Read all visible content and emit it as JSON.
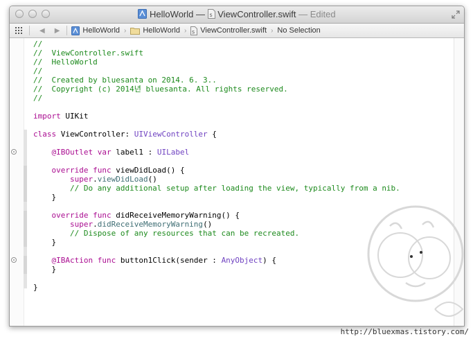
{
  "titlebar": {
    "project": "HelloWorld",
    "separator": "—",
    "file": "ViewController.swift",
    "status": "Edited"
  },
  "jumpbar": {
    "crumbs": [
      {
        "label": "HelloWorld",
        "icon": "xcode-project-icon"
      },
      {
        "label": "HelloWorld",
        "icon": "folder-icon"
      },
      {
        "label": "ViewController.swift",
        "icon": "swift-file-icon"
      },
      {
        "label": "No Selection",
        "icon": ""
      }
    ]
  },
  "code_lines": [
    [
      {
        "t": "//",
        "c": "c"
      }
    ],
    [
      {
        "t": "//  ViewController.swift",
        "c": "c"
      }
    ],
    [
      {
        "t": "//  HelloWorld",
        "c": "c"
      }
    ],
    [
      {
        "t": "//",
        "c": "c"
      }
    ],
    [
      {
        "t": "//  Created by bluesanta on 2014. 6. 3..",
        "c": "c"
      }
    ],
    [
      {
        "t": "//  Copyright (c) 2014년 bluesanta. All rights reserved.",
        "c": "c"
      }
    ],
    [
      {
        "t": "//",
        "c": "c"
      }
    ],
    [
      {
        "t": "",
        "c": ""
      }
    ],
    [
      {
        "t": "import",
        "c": "k"
      },
      {
        "t": " UIKit",
        "c": ""
      }
    ],
    [
      {
        "t": "",
        "c": ""
      }
    ],
    [
      {
        "t": "class",
        "c": "k"
      },
      {
        "t": " ViewController: ",
        "c": ""
      },
      {
        "t": "UIViewController",
        "c": "t"
      },
      {
        "t": " {",
        "c": ""
      }
    ],
    [
      {
        "t": "",
        "c": ""
      }
    ],
    [
      {
        "t": "    ",
        "c": ""
      },
      {
        "t": "@IBOutlet",
        "c": "k"
      },
      {
        "t": " ",
        "c": ""
      },
      {
        "t": "var",
        "c": "k"
      },
      {
        "t": " label1 : ",
        "c": ""
      },
      {
        "t": "UILabel",
        "c": "t"
      }
    ],
    [
      {
        "t": "",
        "c": ""
      }
    ],
    [
      {
        "t": "    ",
        "c": ""
      },
      {
        "t": "override",
        "c": "k"
      },
      {
        "t": " ",
        "c": ""
      },
      {
        "t": "func",
        "c": "k"
      },
      {
        "t": " viewDidLoad() {",
        "c": ""
      }
    ],
    [
      {
        "t": "        ",
        "c": ""
      },
      {
        "t": "super",
        "c": "k"
      },
      {
        "t": ".",
        "c": ""
      },
      {
        "t": "viewDidLoad",
        "c": "m"
      },
      {
        "t": "()",
        "c": ""
      }
    ],
    [
      {
        "t": "        // Do any additional setup after loading the view, typically from a nib.",
        "c": "c"
      }
    ],
    [
      {
        "t": "    }",
        "c": ""
      }
    ],
    [
      {
        "t": "",
        "c": ""
      }
    ],
    [
      {
        "t": "    ",
        "c": ""
      },
      {
        "t": "override",
        "c": "k"
      },
      {
        "t": " ",
        "c": ""
      },
      {
        "t": "func",
        "c": "k"
      },
      {
        "t": " didReceiveMemoryWarning() {",
        "c": ""
      }
    ],
    [
      {
        "t": "        ",
        "c": ""
      },
      {
        "t": "super",
        "c": "k"
      },
      {
        "t": ".",
        "c": ""
      },
      {
        "t": "didReceiveMemoryWarning",
        "c": "m"
      },
      {
        "t": "()",
        "c": ""
      }
    ],
    [
      {
        "t": "        // Dispose of any resources that can be recreated.",
        "c": "c"
      }
    ],
    [
      {
        "t": "    }",
        "c": ""
      }
    ],
    [
      {
        "t": "",
        "c": ""
      }
    ],
    [
      {
        "t": "    ",
        "c": ""
      },
      {
        "t": "@IBAction",
        "c": "k"
      },
      {
        "t": " ",
        "c": ""
      },
      {
        "t": "func",
        "c": "k"
      },
      {
        "t": " button1Click(sender : ",
        "c": ""
      },
      {
        "t": "AnyObject",
        "c": "t"
      },
      {
        "t": ") {",
        "c": ""
      }
    ],
    [
      {
        "t": "    }",
        "c": ""
      }
    ],
    [
      {
        "t": "",
        "c": ""
      }
    ],
    [
      {
        "t": "}",
        "c": ""
      }
    ]
  ],
  "watermark_url": "http://bluexmas.tistory.com/"
}
